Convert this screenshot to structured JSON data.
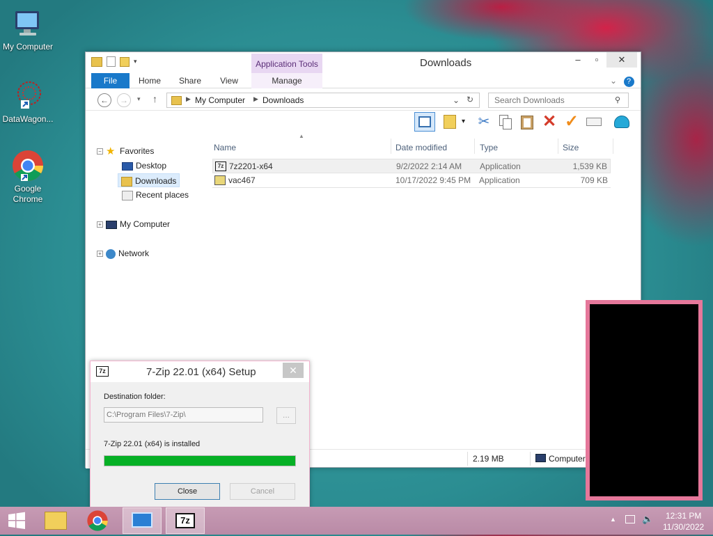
{
  "desktop": {
    "icons": [
      {
        "label": "My Computer",
        "icon": "computer-icon"
      },
      {
        "label": "DataWagon...",
        "icon": "datawagon-icon"
      },
      {
        "label": "Google Chrome",
        "icon": "chrome-icon"
      }
    ]
  },
  "explorer": {
    "title": "Downloads",
    "contextual_tab_group": "Application Tools",
    "tabs": {
      "file": "File",
      "home": "Home",
      "share": "Share",
      "view": "View",
      "manage": "Manage"
    },
    "breadcrumb": [
      "My Computer",
      "Downloads"
    ],
    "search_placeholder": "Search Downloads",
    "nav": {
      "favorites": "Favorites",
      "desktop": "Desktop",
      "downloads": "Downloads",
      "recent": "Recent places",
      "computer": "My Computer",
      "network": "Network"
    },
    "columns": {
      "name": "Name",
      "date": "Date modified",
      "type": "Type",
      "size": "Size"
    },
    "files": [
      {
        "name": "7z2201-x64",
        "date": "9/2/2022 2:14 AM",
        "type": "Application",
        "size": "1,539 KB"
      },
      {
        "name": "vac467",
        "date": "10/17/2022 9:45 PM",
        "type": "Application",
        "size": "709 KB"
      }
    ],
    "status": {
      "size": "2.19 MB",
      "location": "Computer"
    }
  },
  "setup_dialog": {
    "title": "7-Zip 22.01 (x64) Setup",
    "icon_text": "7z",
    "dest_label": "Destination folder:",
    "dest_value": "C:\\Program Files\\7-Zip\\",
    "browse_label": "...",
    "status_text": "7-Zip 22.01 (x64) is installed",
    "progress": 1.0,
    "close_label": "Close",
    "cancel_label": "Cancel",
    "close_glyph": "✕"
  },
  "taskbar": {
    "time": "12:31 PM",
    "date": "11/30/2022",
    "zip_icon_text": "7z"
  },
  "colors": {
    "accent": "#1979ca",
    "progress": "#06b025",
    "taskbar": "#c79bb4"
  }
}
